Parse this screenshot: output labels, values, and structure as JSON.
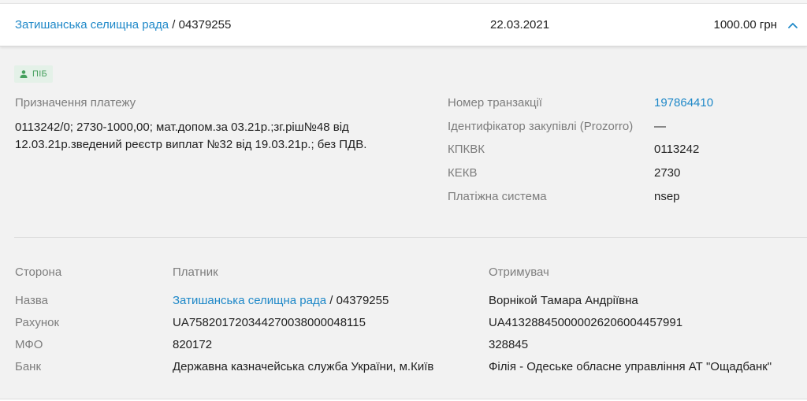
{
  "header": {
    "payer_link": "Затишанська селищна рада",
    "payer_code": " / 04379255",
    "date": "22.03.2021",
    "amount": "1000.00 грн"
  },
  "badge": {
    "label": "ПІБ",
    "icon": "person-icon",
    "color": "#46a05e"
  },
  "purpose": {
    "label": "Призначення платежу",
    "text": "0113242/0; 2730-1000,00; мат.допом.за 03.21р.;зг.рiш№48 вiд 12.03.21р.зведений реєстр виплат №32 вiд 19.03.21р.; без ПДВ."
  },
  "meta": {
    "transaction_label": "Номер транзакції",
    "transaction_value": "197864410",
    "prozorro_label": "Ідентифікатор закупівлі (Prozorro)",
    "prozorro_value": "—",
    "kpkvk_label": "КПКВК",
    "kpkvk_value": "0113242",
    "kekv_label": "КЕКВ",
    "kekv_value": "2730",
    "system_label": "Платіжна система",
    "system_value": "nsep"
  },
  "parties": {
    "headers": {
      "side": "Сторона",
      "payer": "Платник",
      "receiver": "Отримувач"
    },
    "name": {
      "label": "Назва",
      "payer_link": "Затишанська селищна рада",
      "payer_code": " / 04379255",
      "receiver": "Ворнікой Тамара Андріївна"
    },
    "account": {
      "label": "Рахунок",
      "payer": "UA758201720344270038000048115",
      "receiver": "UA413288450000026206004457991"
    },
    "mfo": {
      "label": "МФО",
      "payer": "820172",
      "receiver": "328845"
    },
    "bank": {
      "label": "Банк",
      "payer": "Державна казначейська служба України, м.Київ",
      "receiver": "Філія - Одеське обласне управління АТ \"Ощадбанк\""
    }
  },
  "colors": {
    "link": "#1e88c8",
    "muted": "#7d7d7d",
    "background": "#f2f2f2"
  }
}
